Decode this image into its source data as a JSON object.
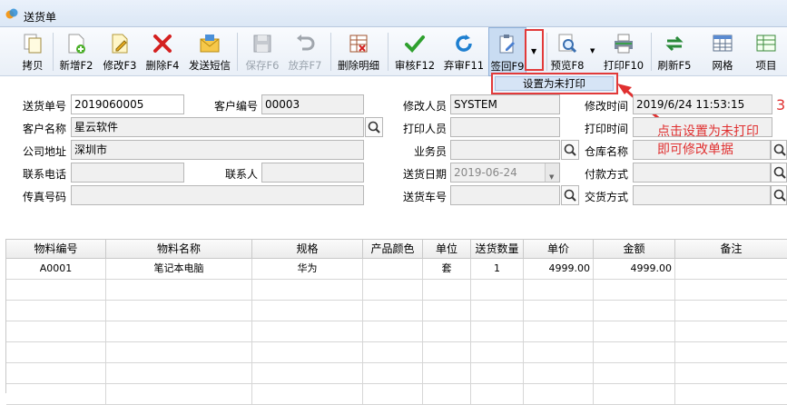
{
  "window": {
    "title": "送货单"
  },
  "toolbar": {
    "buttons": [
      {
        "label": "拷贝"
      },
      {
        "label": "新增F2"
      },
      {
        "label": "修改F3"
      },
      {
        "label": "删除F4"
      },
      {
        "label": "发送短信"
      },
      {
        "label": "保存F6"
      },
      {
        "label": "放弃F7"
      },
      {
        "label": "删除明细"
      },
      {
        "label": "审核F12"
      },
      {
        "label": "弃审F11"
      },
      {
        "label": "签回F9"
      },
      {
        "label": "预览F8"
      },
      {
        "label": "打印F10"
      },
      {
        "label": "刷新F5"
      },
      {
        "label": "网格"
      },
      {
        "label": "项目"
      }
    ]
  },
  "dropdown_menu": {
    "item": "设置为未打印"
  },
  "annotation": {
    "step": "3",
    "line1": "点击设置为未打印",
    "line2": "即可修改单据"
  },
  "form": {
    "delivery_no_label": "送货单号",
    "delivery_no": "2019060005",
    "customer_no_label": "客户编号",
    "customer_no": "00003",
    "customer_name_label": "客户名称",
    "customer_name": "星云软件",
    "company_address_label": "公司地址",
    "company_address": "深圳市",
    "phone_label": "联系电话",
    "phone": "",
    "contact_label": "联系人",
    "contact": "",
    "fax_label": "传真号码",
    "fax": "",
    "modifier_label": "修改人员",
    "modifier": "SYSTEM",
    "printer_label": "打印人员",
    "printer": "",
    "salesman_label": "业务员",
    "salesman": "",
    "delivery_date_label": "送货日期",
    "delivery_date": "2019-06-24",
    "vehicle_label": "送货车号",
    "vehicle": "",
    "modify_time_label": "修改时间",
    "modify_time": "2019/6/24 11:53:15",
    "print_time_label": "打印时间",
    "warehouse_label": "仓库名称",
    "payment_label": "付款方式",
    "trade_label": "交货方式"
  },
  "grid": {
    "columns": [
      "物料编号",
      "物料名称",
      "规格",
      "产品颜色",
      "单位",
      "送货数量",
      "单价",
      "金额",
      "备注"
    ],
    "rows": [
      [
        "A0001",
        "笔记本电脑",
        "华为",
        "",
        "套",
        "1",
        "4999.00",
        "4999.00",
        ""
      ]
    ]
  },
  "colors": {
    "accent": "#e23a3a",
    "toolbar_bg": "#eef3fa"
  }
}
